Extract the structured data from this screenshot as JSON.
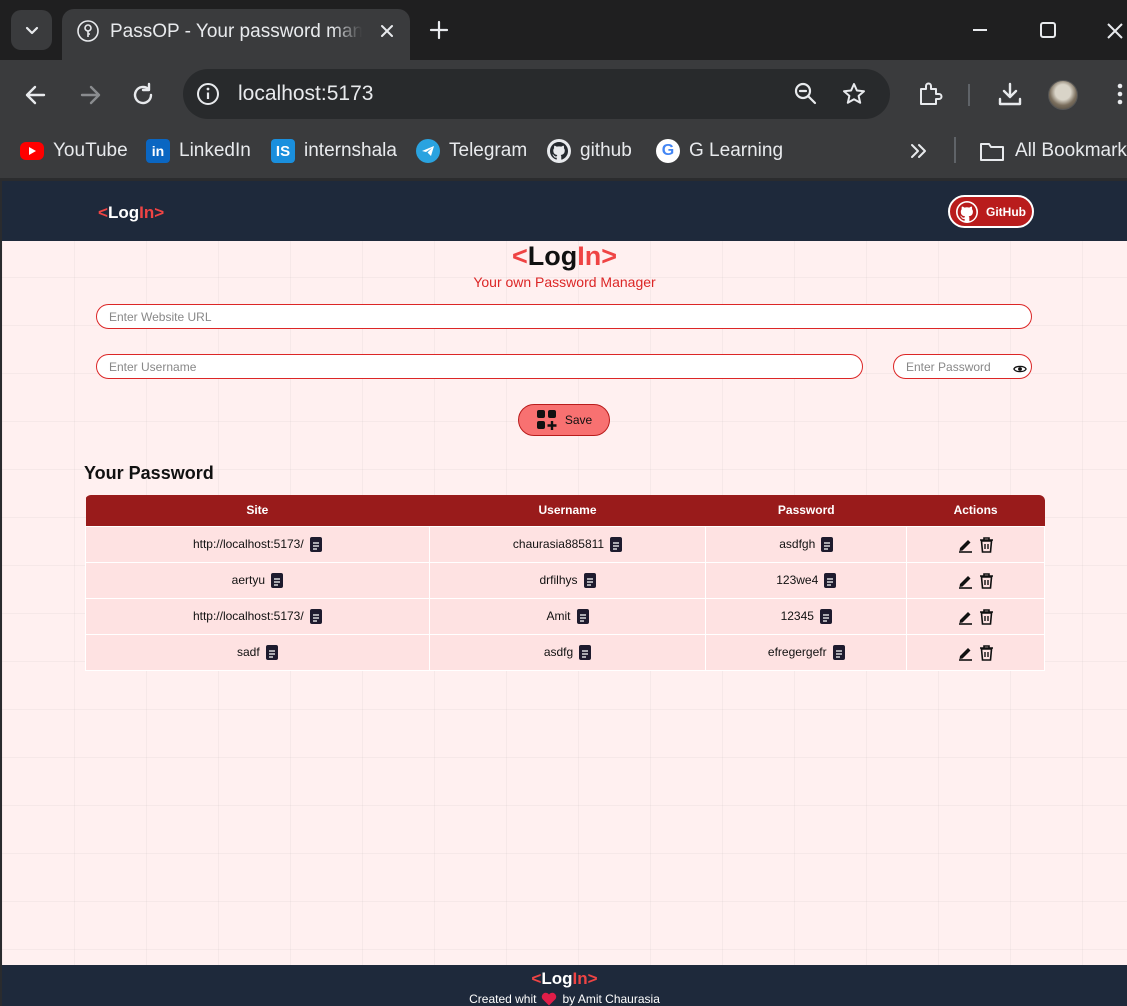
{
  "browser": {
    "tab": {
      "title": "PassOP - Your password manager"
    },
    "url": "localhost:5173",
    "bookmarks": [
      {
        "label": "YouTube",
        "icon": "youtube-icon"
      },
      {
        "label": "LinkedIn",
        "icon": "linkedin-icon"
      },
      {
        "label": "internshala",
        "icon": "internshala-icon"
      },
      {
        "label": "Telegram",
        "icon": "telegram-icon"
      },
      {
        "label": "github",
        "icon": "github-icon"
      },
      {
        "label": "G Learning",
        "icon": "google-icon"
      }
    ],
    "all_bookmarks": "All Bookmarks"
  },
  "navbar": {
    "logo": {
      "open": "<",
      "log": "Log",
      "in": "In",
      "close": ">"
    },
    "github_label": "GitHub"
  },
  "hero": {
    "logo": {
      "open": "<",
      "log": "Log",
      "in": "In",
      "close": ">"
    },
    "tagline": "Your own Password Manager"
  },
  "form": {
    "url_placeholder": "Enter Website URL",
    "username_placeholder": "Enter Username",
    "password_placeholder": "Enter Password",
    "save_label": "Save"
  },
  "passwords": {
    "title": "Your Password",
    "columns": [
      "Site",
      "Username",
      "Password",
      "Actions"
    ],
    "rows": [
      {
        "site": "http://localhost:5173/",
        "username": "chaurasia885811",
        "password": "asdfgh"
      },
      {
        "site": "aertyu",
        "username": "drfilhys",
        "password": "123we4"
      },
      {
        "site": "http://localhost:5173/",
        "username": "Amit",
        "password": "12345"
      },
      {
        "site": "sadf",
        "username": "asdfg",
        "password": "efregergefr"
      }
    ]
  },
  "footer": {
    "logo": {
      "open": "<",
      "log": "Log",
      "in": "In",
      "close": ">"
    },
    "credit_before": "Created whit",
    "credit_after": "by Amit Chaurasia"
  },
  "colors": {
    "navbar_bg": "#1e293b",
    "accent_red": "#ef4444",
    "table_header": "#991b1b",
    "table_cell": "#fee2e2",
    "save_button": "#f87171",
    "page_bg": "#fff0f0"
  }
}
